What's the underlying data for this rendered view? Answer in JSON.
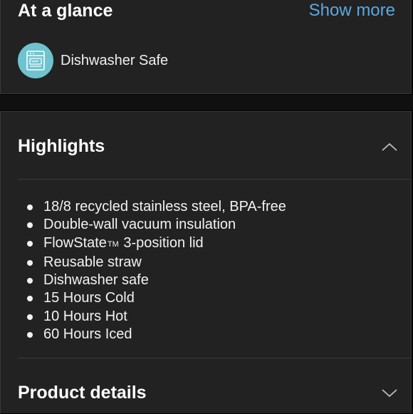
{
  "glance": {
    "title": "At a glance",
    "show_more": "Show more",
    "items": [
      {
        "label": "Dishwasher Safe",
        "icon": "dishwasher-icon"
      }
    ]
  },
  "highlights": {
    "title": "Highlights",
    "expanded": true,
    "items": [
      {
        "text": "18/8 recycled stainless steel, BPA-free"
      },
      {
        "text": "Double-wall vacuum insulation"
      },
      {
        "text": "FlowState",
        "tm": "TM",
        "suffix": " 3-position lid"
      },
      {
        "text": "Reusable straw"
      },
      {
        "text": "Dishwasher safe"
      },
      {
        "text": "15 Hours Cold"
      },
      {
        "text": "10 Hours Hot"
      },
      {
        "text": "60 Hours Iced"
      }
    ]
  },
  "product_details": {
    "title": "Product details",
    "expanded": false
  },
  "colors": {
    "link": "#5aa8e0",
    "icon_bg": "#6fc3cf",
    "panel_bg": "#222222",
    "page_bg": "#000000"
  }
}
